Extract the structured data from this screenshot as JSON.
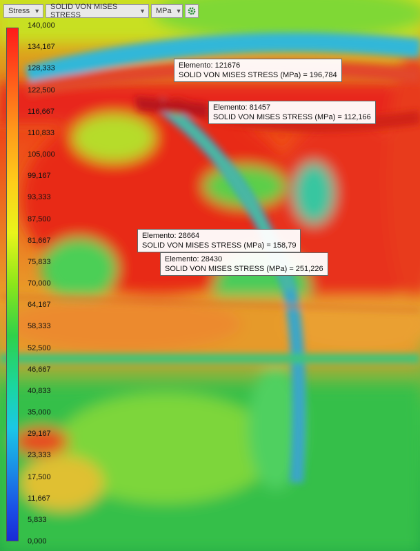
{
  "toolbar": {
    "result_type": "Stress",
    "component": "SOLID VON MISES STRESS",
    "unit": "MPa"
  },
  "legend": {
    "ticks": [
      "140,000",
      "134,167",
      "128,333",
      "122,500",
      "116,667",
      "110,833",
      "105,000",
      "99,167",
      "93,333",
      "87,500",
      "81,667",
      "75,833",
      "70,000",
      "64,167",
      "58,333",
      "52,500",
      "46,667",
      "40,833",
      "35,000",
      "29,167",
      "23,333",
      "17,500",
      "11,667",
      "5,833",
      "0,000"
    ]
  },
  "probes": [
    {
      "element": "Elemento: 121676",
      "value": "SOLID VON MISES STRESS (MPa)  = 196,784"
    },
    {
      "element": "Elemento: 81457",
      "value": "SOLID VON MISES STRESS (MPa)  = 112,166"
    },
    {
      "element": "Elemento: 28664",
      "value": "SOLID VON MISES STRESS (MPa)  = 158,79"
    },
    {
      "element": "Elemento: 28430",
      "value": "SOLID VON MISES STRESS (MPa)  = 251,226"
    }
  ],
  "icons": {
    "gear": "gear-icon",
    "dropdown": "chevron-down-icon"
  }
}
